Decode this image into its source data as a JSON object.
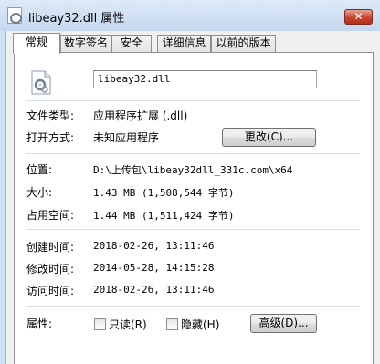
{
  "window": {
    "title": "libeay32.dll 属性",
    "close_label": "✕"
  },
  "tabs": [
    {
      "label": "常规",
      "active": true
    },
    {
      "label": "数字签名",
      "active": false
    },
    {
      "label": "安全",
      "active": false
    },
    {
      "label": "详细信息",
      "active": false
    },
    {
      "label": "以前的版本",
      "active": false
    }
  ],
  "general": {
    "file_name": "libeay32.dll",
    "file_type_label": "文件类型:",
    "file_type_value": "应用程序扩展 (.dll)",
    "opens_with_label": "打开方式:",
    "opens_with_value": "未知应用程序",
    "change_button": "更改(C)...",
    "location_label": "位置:",
    "location_value": "D:\\上传包\\libeay32dll_331c.com\\x64",
    "size_label": "大小:",
    "size_value": "1.43 MB (1,508,544 字节)",
    "size_on_disk_label": "占用空间:",
    "size_on_disk_value": "1.44 MB (1,511,424 字节)",
    "created_label": "创建时间:",
    "created_value": "2018-02-26, 13:11:46",
    "modified_label": "修改时间:",
    "modified_value": "2014-05-28, 14:15:28",
    "accessed_label": "访问时间:",
    "accessed_value": "2018-02-26, 13:11:46",
    "attributes_label": "属性:",
    "readonly_label": "只读(R)",
    "readonly_checked": false,
    "hidden_label": "隐藏(H)",
    "hidden_checked": false,
    "advanced_button": "高级(D)..."
  },
  "icons": {
    "title": "dll-file-icon",
    "file": "dll-gear-file-icon"
  }
}
